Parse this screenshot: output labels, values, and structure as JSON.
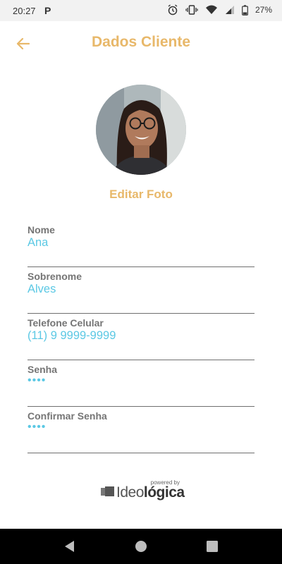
{
  "status_bar": {
    "time": "20:27",
    "notification_app": "P",
    "icons": [
      "alarm-icon",
      "vibrate-icon",
      "wifi-icon",
      "signal-icon",
      "battery-icon"
    ],
    "battery_percent": "27%"
  },
  "header": {
    "title": "Dados Cliente",
    "back_icon": "arrow-left-icon"
  },
  "profile": {
    "edit_photo_label": "Editar Foto"
  },
  "form": {
    "fields": [
      {
        "label": "Nome",
        "value": "Ana"
      },
      {
        "label": "Sobrenome",
        "value": "Alves"
      },
      {
        "label": "Telefone Celular",
        "value": "(11) 9 9999-9999"
      },
      {
        "label": "Senha",
        "value": "••••"
      },
      {
        "label": "Confirmar Senha",
        "value": "••••"
      }
    ]
  },
  "footer": {
    "powered_by": "powered by",
    "brand_prefix": "Ideo",
    "brand_suffix": "lógica"
  },
  "nav_bar": {
    "icons": [
      "back-triangle-icon",
      "home-circle-icon",
      "recents-square-icon"
    ]
  },
  "colors": {
    "accent": "#e8b86a",
    "field_value": "#5bc8e4",
    "label": "#757575",
    "divider": "#6f6f6f"
  }
}
